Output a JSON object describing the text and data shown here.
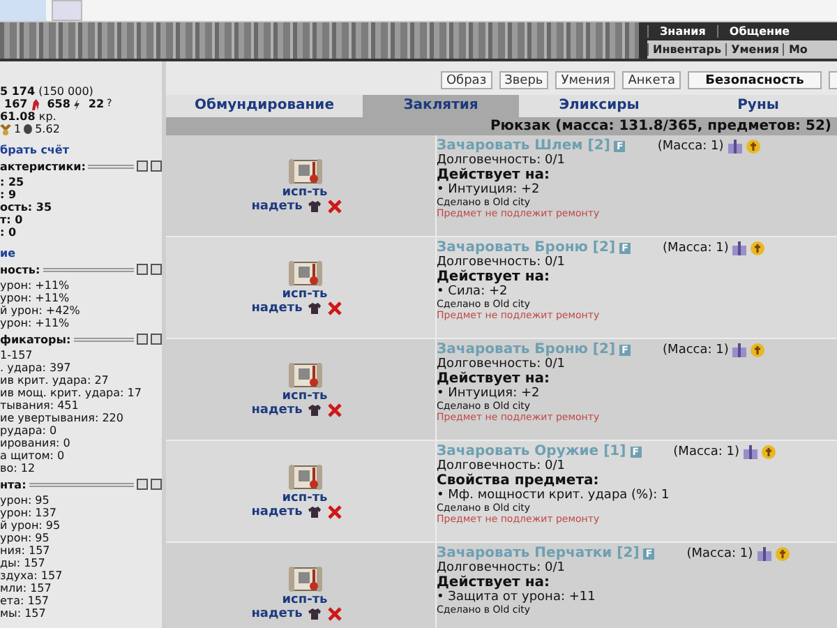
{
  "top_menu": {
    "primary": [
      "Знания",
      "Общение"
    ],
    "secondary": [
      "Инвентарь",
      "Умения",
      "Мо"
    ]
  },
  "profile_buttons": [
    {
      "label": "Образ",
      "kind": "plain"
    },
    {
      "label": "Зверь",
      "kind": "plain"
    },
    {
      "label": "Умения",
      "kind": "plain"
    },
    {
      "label": "Анкета",
      "kind": "plain"
    },
    {
      "label": "Безопасность",
      "kind": "strong"
    },
    {
      "kind": "cut"
    }
  ],
  "sidebar": [
    {
      "kind": "rich",
      "text": "**5 174** (150 000)"
    },
    {
      "kind": "counters",
      "items": [
        {
          "kind": "value",
          "text": "167"
        },
        {
          "kind": "flame"
        },
        {
          "kind": "value",
          "text": "658"
        },
        {
          "kind": "bolt"
        },
        {
          "kind": "value",
          "text": "22"
        },
        {
          "kind": "note",
          "text": "?"
        }
      ]
    },
    {
      "kind": "rich",
      "text": "**61.08** кр."
    },
    {
      "kind": "counters",
      "items": [
        {
          "kind": "medal"
        },
        {
          "kind": "plain",
          "text": "1"
        },
        {
          "kind": "coin"
        },
        {
          "kind": "plain",
          "text": "5.62"
        }
      ]
    },
    {
      "kind": "link",
      "text": "брать счёт"
    },
    {
      "kind": "header",
      "text": "актеристики:"
    },
    {
      "kind": "bold",
      "text": ": 25"
    },
    {
      "kind": "bold",
      "text": ": 9"
    },
    {
      "kind": "bold",
      "text": "ость: 35"
    },
    {
      "kind": "bold",
      "text": "т: 0"
    },
    {
      "kind": "bold",
      "text": ": 0"
    },
    {
      "kind": "link",
      "text": "ие"
    },
    {
      "kind": "header",
      "text": "ность:"
    },
    {
      "kind": "text",
      "text": "урон: +11%"
    },
    {
      "kind": "text",
      "text": "урон: +11%"
    },
    {
      "kind": "text",
      "text": "й урон: +42%"
    },
    {
      "kind": "text",
      "text": "урон: +11%"
    },
    {
      "kind": "header",
      "text": "фикаторы:"
    },
    {
      "kind": "text",
      "text": "1-157"
    },
    {
      "kind": "text",
      "text": ". удара: 397"
    },
    {
      "kind": "text",
      "text": "ив крит. удара: 27"
    },
    {
      "kind": "text",
      "text": "ив мощ. крит. удара: 17"
    },
    {
      "kind": "text",
      "text": "тывания: 451"
    },
    {
      "kind": "text",
      "text": "ие увертывания: 220"
    },
    {
      "kind": "text",
      "text": "рудара: 0"
    },
    {
      "kind": "text",
      "text": "ирования: 0"
    },
    {
      "kind": "text",
      "text": "а щитом: 0"
    },
    {
      "kind": "text",
      "text": "во: 12"
    },
    {
      "kind": "header",
      "text": "нта:"
    },
    {
      "kind": "text",
      "text": "урон: 95"
    },
    {
      "kind": "text",
      "text": "урон: 137"
    },
    {
      "kind": "text",
      "text": "й урон: 95"
    },
    {
      "kind": "text",
      "text": "урон: 95"
    },
    {
      "kind": "text",
      "text": "ния: 157"
    },
    {
      "kind": "text",
      "text": "ды: 157"
    },
    {
      "kind": "text",
      "text": "здуха: 157"
    },
    {
      "kind": "text",
      "text": "мли: 157"
    },
    {
      "kind": "text",
      "text": "ета: 157"
    },
    {
      "kind": "text",
      "text": "мы: 157"
    }
  ],
  "tabs": [
    {
      "label": "Обмундирование",
      "selected": false
    },
    {
      "label": "Заклятия",
      "selected": true
    },
    {
      "label": "Эликсиры",
      "selected": false
    },
    {
      "label": "Руны",
      "selected": false
    }
  ],
  "backpack_title": "Рюкзак (масса: 131.8/365, предметов: 52)",
  "items": [
    {
      "use": "исп-ть",
      "wear": "надеть",
      "title": "Зачаровать Шлем [2]",
      "badge": "F",
      "mass": "(Масса: 1)",
      "durability": "Долговечность: 0/1",
      "section": "Действует на:",
      "effects": [
        "• Интуиция: +2"
      ],
      "made": "Сделано в Old city",
      "note": "Предмет не подлежит ремонту"
    },
    {
      "use": "исп-ть",
      "wear": "надеть",
      "title": "Зачаровать Броню [2]",
      "badge": "F",
      "mass": "(Масса: 1)",
      "durability": "Долговечность: 0/1",
      "section": "Действует на:",
      "effects": [
        "• Сила: +2"
      ],
      "made": "Сделано в Old city",
      "note": "Предмет не подлежит ремонту"
    },
    {
      "use": "исп-ть",
      "wear": "надеть",
      "title": "Зачаровать Броню [2]",
      "badge": "F",
      "mass": "(Масса: 1)",
      "durability": "Долговечность: 0/1",
      "section": "Действует на:",
      "effects": [
        "• Интуиция: +2"
      ],
      "made": "Сделано в Old city",
      "note": "Предмет не подлежит ремонту"
    },
    {
      "use": "исп-ть",
      "wear": "надеть",
      "title": "Зачаровать Оружие [1]",
      "badge": "F",
      "mass": "(Масса: 1)",
      "durability": "Долговечность: 0/1",
      "section": "Свойства предмета:",
      "effects": [
        "• Мф. мощности крит. удара (%): 1"
      ],
      "made": "Сделано в Old city",
      "note": "Предмет не подлежит ремонту"
    },
    {
      "use": "исп-ть",
      "wear": "надеть",
      "title": "Зачаровать Перчатки [2]",
      "badge": "F",
      "mass": "(Масса: 1)",
      "durability": "Долговечность: 0/1",
      "section": "Действует на:",
      "effects": [
        "• Защита от урона: +11"
      ],
      "made": "Сделано в Old city"
    }
  ]
}
